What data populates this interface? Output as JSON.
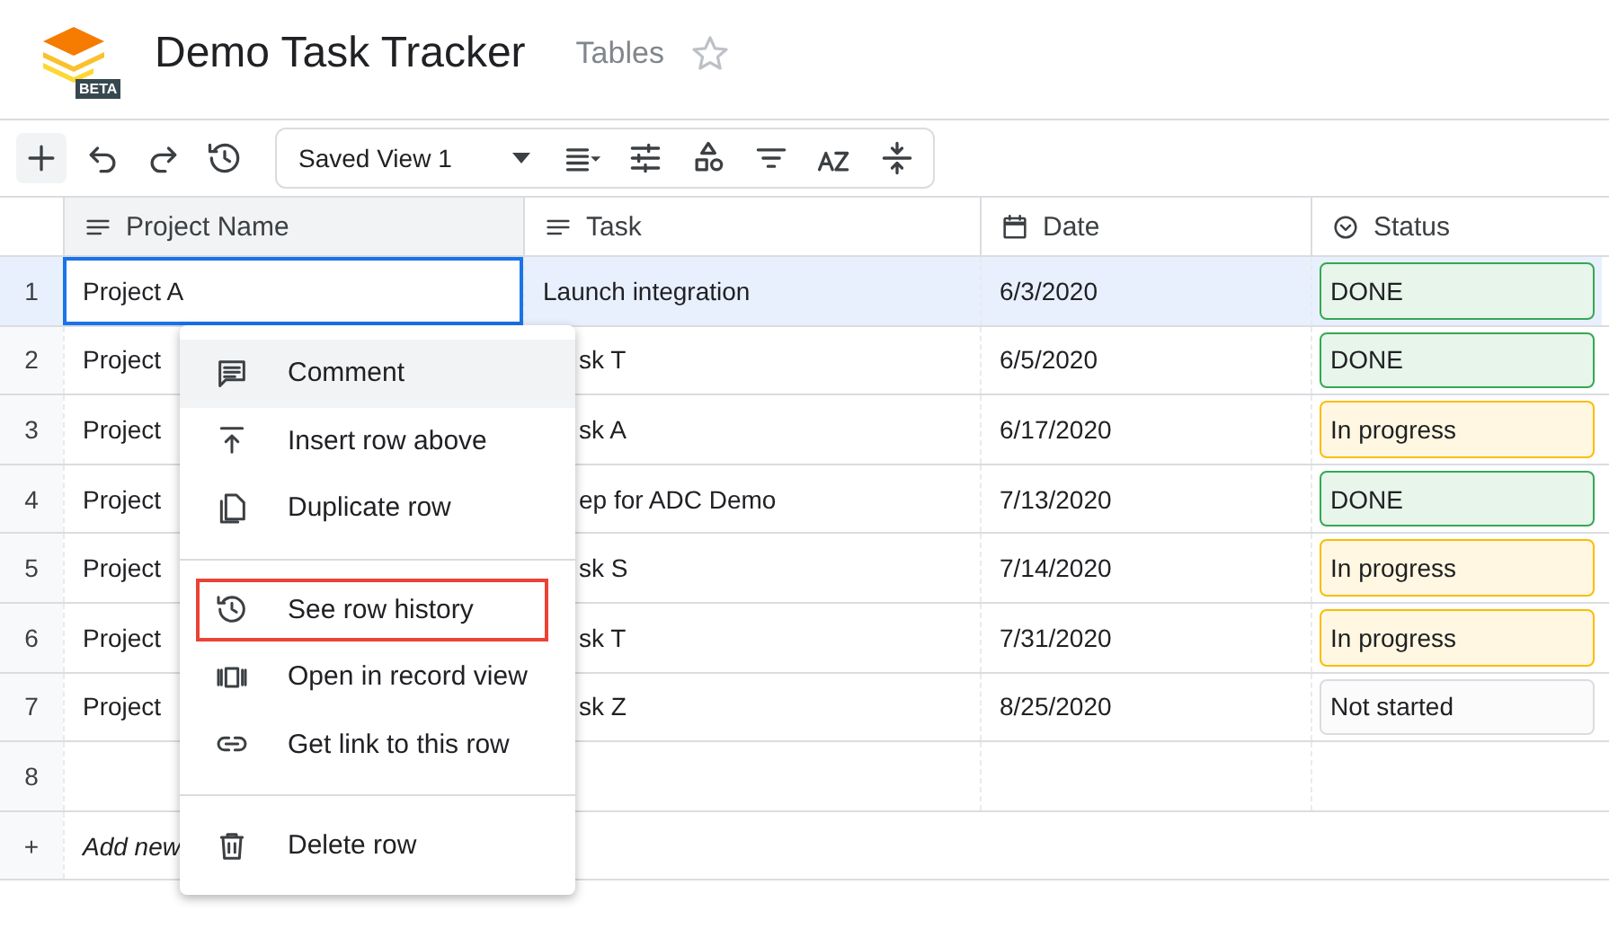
{
  "app": {
    "title": "Demo Task Tracker",
    "product": "Tables",
    "logo_badge": "BETA",
    "starred": false
  },
  "toolbar": {
    "view": "Saved View 1"
  },
  "table": {
    "columns": [
      {
        "label": "Project Name",
        "selected": true
      },
      {
        "label": "Task",
        "selected": false
      },
      {
        "label": "Date",
        "selected": false
      },
      {
        "label": "Status",
        "selected": false
      }
    ],
    "rows": [
      {
        "number": "1",
        "project": "Project A",
        "task": "Launch integration",
        "date": "6/3/2020",
        "status": {
          "label": "DONE",
          "color": "#34a853"
        },
        "selected": true
      },
      {
        "number": "2",
        "project": "Project",
        "task": "sk T",
        "date": "6/5/2020",
        "status": {
          "label": "DONE",
          "color": "#34a853"
        },
        "selected": false
      },
      {
        "number": "3",
        "project": "Project",
        "task": "sk A",
        "date": "6/17/2020",
        "status": {
          "label": "In progress",
          "color": "#fbbc04"
        },
        "selected": false
      },
      {
        "number": "4",
        "project": "Project",
        "task": "ep for ADC Demo",
        "date": "7/13/2020",
        "status": {
          "label": "DONE",
          "color": "#34a853"
        },
        "selected": false
      },
      {
        "number": "5",
        "project": "Project",
        "task": "sk S",
        "date": "7/14/2020",
        "status": {
          "label": "In progress",
          "color": "#fbbc04"
        },
        "selected": false
      },
      {
        "number": "6",
        "project": "Project",
        "task": "sk T",
        "date": "7/31/2020",
        "status": {
          "label": "In progress",
          "color": "#fbbc04"
        },
        "selected": false
      },
      {
        "number": "7",
        "project": "Project",
        "task": "sk Z",
        "date": "8/25/2020",
        "status": {
          "label": "Not started",
          "color": "#dadce0"
        },
        "selected": false
      },
      {
        "number": "8",
        "selected": false
      }
    ],
    "add_row": {
      "icon_text": "+",
      "label": "Add new"
    }
  },
  "context_menu": {
    "sections": [
      [
        {
          "label": "Comment",
          "highlighted": true,
          "outlined": false
        },
        {
          "label": "Insert row above",
          "highlighted": false,
          "outlined": false
        },
        {
          "label": "Duplicate row",
          "highlighted": false,
          "outlined": false
        }
      ],
      [
        {
          "label": "See row history",
          "highlighted": false,
          "outlined": true
        },
        {
          "label": "Open in record view",
          "highlighted": false,
          "outlined": false
        },
        {
          "label": "Get link to this row",
          "highlighted": false,
          "outlined": false
        }
      ],
      [
        {
          "label": "Delete row",
          "highlighted": false,
          "outlined": false
        }
      ]
    ]
  }
}
